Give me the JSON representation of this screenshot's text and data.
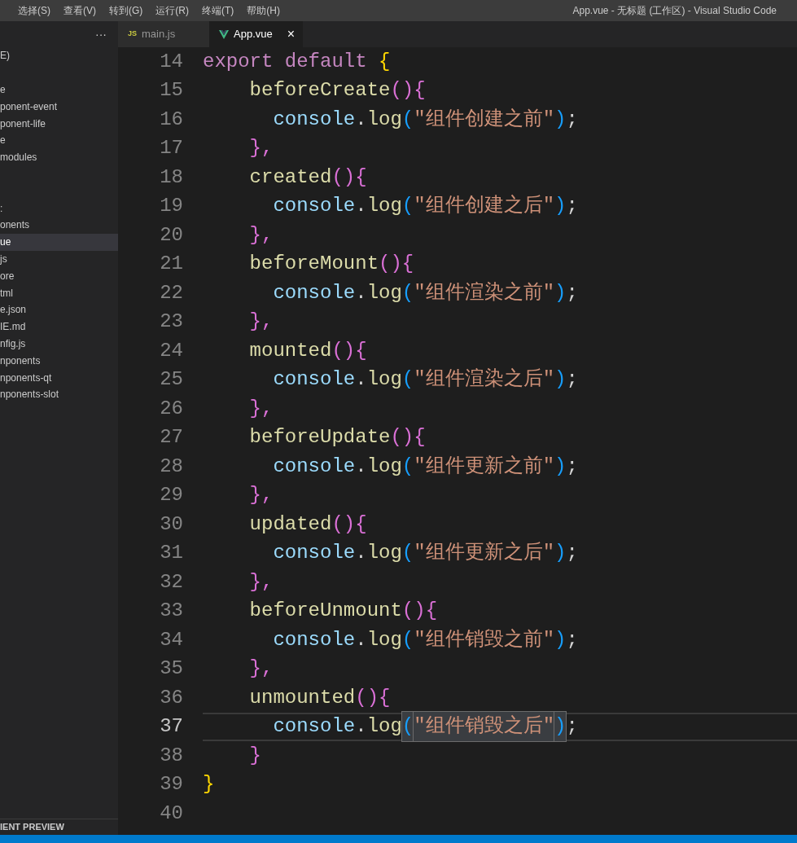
{
  "menu_bar": {
    "items": [
      "选择(S)",
      "查看(V)",
      "转到(G)",
      "运行(R)",
      "终端(T)",
      "帮助(H)"
    ],
    "title": "App.vue - 无标题 (工作区) - Visual Studio Code"
  },
  "sidebar": {
    "more": "···",
    "items": [
      {
        "label": "E)",
        "selected": false
      },
      {
        "selected": false
      },
      {
        "label": "e",
        "selected": false
      },
      {
        "label": "ponent-event",
        "selected": false
      },
      {
        "label": "ponent-life",
        "selected": false
      },
      {
        "label": "e",
        "selected": false
      },
      {
        "label": "modules",
        "selected": false
      },
      {
        "selected": false
      },
      {
        "selected": false
      },
      {
        "label": ":",
        "selected": false
      },
      {
        "label": "onents",
        "selected": false
      },
      {
        "label": "ue",
        "selected": true
      },
      {
        "label": "js",
        "selected": false
      },
      {
        "label": "ore",
        "selected": false
      },
      {
        "label": "tml",
        "selected": false
      },
      {
        "label": "e.json",
        "selected": false
      },
      {
        "label": "IE.md",
        "selected": false
      },
      {
        "label": "nfig.js",
        "selected": false
      },
      {
        "label": "nponents",
        "selected": false
      },
      {
        "label": "nponents-qt",
        "selected": false
      },
      {
        "label": "nponents-slot",
        "selected": false
      }
    ],
    "section": "IENT PREVIEW"
  },
  "tabs": [
    {
      "label": "main.js",
      "kind": "js",
      "icon_text": "JS",
      "selected": false
    },
    {
      "label": "App.vue",
      "kind": "vue",
      "selected": true,
      "close": "×"
    }
  ],
  "editor": {
    "lines": [
      {
        "number": "14",
        "current": false,
        "tokens": [
          {
            "text": "export default ",
            "kind": "keyword"
          },
          {
            "text": "{",
            "kind": "gold"
          }
        ]
      },
      {
        "number": "15",
        "current": false,
        "tokens": [
          {
            "text": "    beforeCreate",
            "kind": "function"
          },
          {
            "text": "(){",
            "kind": "pink"
          }
        ]
      },
      {
        "number": "16",
        "current": false,
        "tokens": [
          {
            "text": "      console",
            "kind": "variable"
          },
          {
            "text": ".",
            "kind": "plain"
          },
          {
            "text": "log",
            "kind": "function"
          },
          {
            "text": "(",
            "kind": "blue"
          },
          {
            "text": "\"组件创建之前\"",
            "kind": "string"
          },
          {
            "text": ")",
            "kind": "blue"
          },
          {
            "text": ";",
            "kind": "plain"
          }
        ]
      },
      {
        "number": "17",
        "current": false,
        "tokens": [
          {
            "text": "    },",
            "kind": "pink"
          }
        ]
      },
      {
        "number": "18",
        "current": false,
        "tokens": [
          {
            "text": "    created",
            "kind": "function"
          },
          {
            "text": "(){",
            "kind": "pink"
          }
        ]
      },
      {
        "number": "19",
        "current": false,
        "tokens": [
          {
            "text": "      console",
            "kind": "variable"
          },
          {
            "text": ".",
            "kind": "plain"
          },
          {
            "text": "log",
            "kind": "function"
          },
          {
            "text": "(",
            "kind": "blue"
          },
          {
            "text": "\"组件创建之后\"",
            "kind": "string"
          },
          {
            "text": ")",
            "kind": "blue"
          },
          {
            "text": ";",
            "kind": "plain"
          }
        ]
      },
      {
        "number": "20",
        "current": false,
        "tokens": [
          {
            "text": "    },",
            "kind": "pink"
          }
        ]
      },
      {
        "number": "21",
        "current": false,
        "tokens": [
          {
            "text": "    beforeMount",
            "kind": "function"
          },
          {
            "text": "(){",
            "kind": "pink"
          }
        ]
      },
      {
        "number": "22",
        "current": false,
        "tokens": [
          {
            "text": "      console",
            "kind": "variable"
          },
          {
            "text": ".",
            "kind": "plain"
          },
          {
            "text": "log",
            "kind": "function"
          },
          {
            "text": "(",
            "kind": "blue"
          },
          {
            "text": "\"组件渲染之前\"",
            "kind": "string"
          },
          {
            "text": ")",
            "kind": "blue"
          },
          {
            "text": ";",
            "kind": "plain"
          }
        ]
      },
      {
        "number": "23",
        "current": false,
        "tokens": [
          {
            "text": "    },",
            "kind": "pink"
          }
        ]
      },
      {
        "number": "24",
        "current": false,
        "tokens": [
          {
            "text": "    mounted",
            "kind": "function"
          },
          {
            "text": "(){",
            "kind": "pink"
          }
        ]
      },
      {
        "number": "25",
        "current": false,
        "tokens": [
          {
            "text": "      console",
            "kind": "variable"
          },
          {
            "text": ".",
            "kind": "plain"
          },
          {
            "text": "log",
            "kind": "function"
          },
          {
            "text": "(",
            "kind": "blue"
          },
          {
            "text": "\"组件渲染之后\"",
            "kind": "string"
          },
          {
            "text": ")",
            "kind": "blue"
          },
          {
            "text": ";",
            "kind": "plain"
          }
        ]
      },
      {
        "number": "26",
        "current": false,
        "tokens": [
          {
            "text": "    },",
            "kind": "pink"
          }
        ]
      },
      {
        "number": "27",
        "current": false,
        "tokens": [
          {
            "text": "    beforeUpdate",
            "kind": "function"
          },
          {
            "text": "(){",
            "kind": "pink"
          }
        ]
      },
      {
        "number": "28",
        "current": false,
        "tokens": [
          {
            "text": "      console",
            "kind": "variable"
          },
          {
            "text": ".",
            "kind": "plain"
          },
          {
            "text": "log",
            "kind": "function"
          },
          {
            "text": "(",
            "kind": "blue"
          },
          {
            "text": "\"组件更新之前\"",
            "kind": "string"
          },
          {
            "text": ")",
            "kind": "blue"
          },
          {
            "text": ";",
            "kind": "plain"
          }
        ]
      },
      {
        "number": "29",
        "current": false,
        "tokens": [
          {
            "text": "    },",
            "kind": "pink"
          }
        ]
      },
      {
        "number": "30",
        "current": false,
        "tokens": [
          {
            "text": "    updated",
            "kind": "function"
          },
          {
            "text": "(){",
            "kind": "pink"
          }
        ]
      },
      {
        "number": "31",
        "current": false,
        "tokens": [
          {
            "text": "      console",
            "kind": "variable"
          },
          {
            "text": ".",
            "kind": "plain"
          },
          {
            "text": "log",
            "kind": "function"
          },
          {
            "text": "(",
            "kind": "blue"
          },
          {
            "text": "\"组件更新之后\"",
            "kind": "string"
          },
          {
            "text": ")",
            "kind": "blue"
          },
          {
            "text": ";",
            "kind": "plain"
          }
        ]
      },
      {
        "number": "32",
        "current": false,
        "tokens": [
          {
            "text": "    },",
            "kind": "pink"
          }
        ]
      },
      {
        "number": "33",
        "current": false,
        "tokens": [
          {
            "text": "    beforeUnmount",
            "kind": "function"
          },
          {
            "text": "(){",
            "kind": "pink"
          }
        ]
      },
      {
        "number": "34",
        "current": false,
        "tokens": [
          {
            "text": "      console",
            "kind": "variable"
          },
          {
            "text": ".",
            "kind": "plain"
          },
          {
            "text": "log",
            "kind": "function"
          },
          {
            "text": "(",
            "kind": "blue"
          },
          {
            "text": "\"组件销毁之前\"",
            "kind": "string"
          },
          {
            "text": ")",
            "kind": "blue"
          },
          {
            "text": ";",
            "kind": "plain"
          }
        ]
      },
      {
        "number": "35",
        "current": false,
        "tokens": [
          {
            "text": "    },",
            "kind": "pink"
          }
        ]
      },
      {
        "number": "36",
        "current": false,
        "tokens": [
          {
            "text": "    unmounted",
            "kind": "function"
          },
          {
            "text": "(){",
            "kind": "pink"
          }
        ]
      },
      {
        "number": "37",
        "current": true,
        "tokens": [
          {
            "text": "      console",
            "kind": "variable"
          },
          {
            "text": ".",
            "kind": "plain"
          },
          {
            "text": "log",
            "kind": "function"
          },
          {
            "text": "(",
            "kind": "blue",
            "highlighted": true
          },
          {
            "text": "\"组件销毁之后\"",
            "kind": "string",
            "highlighted": true
          },
          {
            "text": ")",
            "kind": "blue",
            "highlighted": true
          },
          {
            "text": ";",
            "kind": "plain"
          }
        ]
      },
      {
        "number": "38",
        "current": false,
        "tokens": [
          {
            "text": "    }",
            "kind": "pink"
          }
        ]
      },
      {
        "number": "39",
        "current": false,
        "tokens": [
          {
            "text": "}",
            "kind": "gold"
          }
        ]
      },
      {
        "number": "40",
        "current": false
      }
    ]
  }
}
